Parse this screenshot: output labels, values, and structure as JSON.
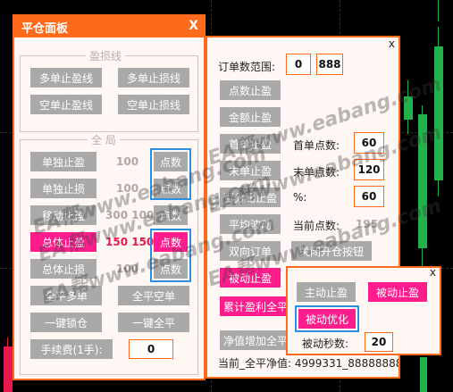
{
  "left_panel": {
    "title": "平仓面板",
    "close": "X",
    "group_sl_tp": {
      "title": "盈损线",
      "buttons": [
        "多单止盈线",
        "多单止损线",
        "空单止盈线",
        "空单止损线"
      ]
    },
    "group_all": {
      "title": "全 局",
      "rows": [
        {
          "label": "单独止盈",
          "value": "100",
          "mode": "点数"
        },
        {
          "label": "单独止损",
          "value": "100",
          "mode": "点数"
        },
        {
          "label": "移动止盈",
          "value": "300 100",
          "mode": "点数"
        },
        {
          "label": "总体止盈",
          "value": "150 150",
          "mode": "点数"
        },
        {
          "label": "总体止损",
          "value": "100",
          "mode": "点数"
        }
      ],
      "btn_close_buy": "全平多单",
      "btn_close_sell": "全平空单",
      "btn_lock": "一键锁仓",
      "btn_close_all": "一键全平",
      "fee_label": "手续费(1手):",
      "fee_value": "0"
    }
  },
  "mid_panel": {
    "close": "x",
    "range_label": "订单数范围:",
    "range_from": "0",
    "range_to": "888",
    "buttons": [
      "点数止盈",
      "金额止盈",
      "首单止盈",
      "末单止盈",
      "百分比止盈",
      "平均波动",
      "双向订单"
    ],
    "first_points_label": "首单点数:",
    "first_points_value": "60",
    "last_points_label": "末单点数:",
    "last_points_value": "120",
    "percent_label": "%:",
    "percent_value": "60",
    "current_points_label": "当前点数:",
    "current_points_value": "195",
    "btn_close_open": "关闭开仓按钮",
    "btn_passive_tp": "被动止盈",
    "btn_cum_profit": "累计盈利全平",
    "btn_equity": "净值增加全平",
    "footer": "当前_全平净值: 4999331_8888888888"
  },
  "popup": {
    "close": "x",
    "btn_active": "主动止盈",
    "btn_passive": "被动止盈",
    "btn_passive_opt": "被动优化",
    "seconds_label": "被动秒数:",
    "seconds_value": "20"
  },
  "watermark": [
    "EA帮www.eabang.com",
    "EA帮www.eabang.com",
    "EA帮www.eabang.com",
    "EA帮www.eabang.com",
    "EA帮www.eabang.com",
    "EA帮www.eabang.com"
  ],
  "colors": {
    "accent": "#ff6a1a",
    "pink": "#ff1d8e",
    "button_grey": "#a9a9a9",
    "highlight_blue": "#2b8ee0",
    "candle_green": "#22b24c",
    "candle_red": "#e8174d"
  }
}
